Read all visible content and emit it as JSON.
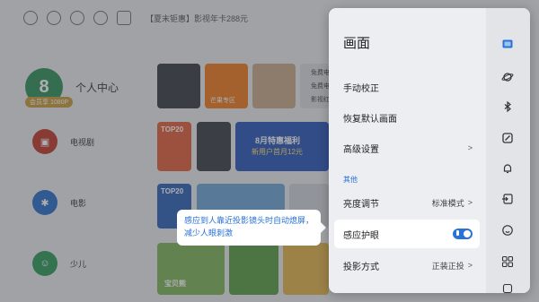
{
  "topbar": {
    "promo": "【夏末钜惠】影视年卡288元",
    "icons": [
      "refresh-icon",
      "search-icon",
      "settings-icon",
      "bag-icon",
      "vip-icon"
    ]
  },
  "home": {
    "profile": {
      "label": "个人中心",
      "badge": "会员享 1080P"
    },
    "categories": [
      {
        "label": "电视剧"
      },
      {
        "label": "电影"
      },
      {
        "label": "少儿"
      }
    ],
    "tiles": {
      "mango_zone": "芒果专区",
      "top20_a": "TOP20",
      "top20_b": "TOP20",
      "promo_card": "8月特惠福利",
      "promo_card_sub": "新用户首月12元",
      "free_1": "免费电",
      "free_2": "免费电",
      "free_3": "影视红",
      "kids_title": "宝贝熊"
    }
  },
  "tooltip": {
    "text": "感应到人靠近投影镜头时自动熄屏，减少人眼刺激"
  },
  "settings": {
    "title": "画面",
    "items": [
      {
        "label": "手动校正",
        "value": "",
        "chevron": false
      },
      {
        "label": "恢复默认画面",
        "value": "",
        "chevron": false
      },
      {
        "label": "高级设置",
        "value": "",
        "chevron": true
      }
    ],
    "section_label": "其他",
    "others": [
      {
        "label": "亮度调节",
        "value": "标准模式",
        "chevron": true
      },
      {
        "label": "感应护眼",
        "value": "",
        "toggle": true,
        "toggle_on": true
      },
      {
        "label": "投影方式",
        "value": "正装正投",
        "chevron": true
      }
    ],
    "rail_icons": [
      "picture-icon",
      "planet-icon",
      "bluetooth-icon",
      "projector-icon",
      "bell-icon",
      "input-icon",
      "face-icon",
      "apps-icon",
      "more-icon"
    ]
  },
  "colors": {
    "accent": "#2a72d6",
    "panel_bg": "#eceef1",
    "rail_bg": "#e2e4e8",
    "category_green": "#2f8f5a",
    "vip_gold": "#c99a3b"
  }
}
